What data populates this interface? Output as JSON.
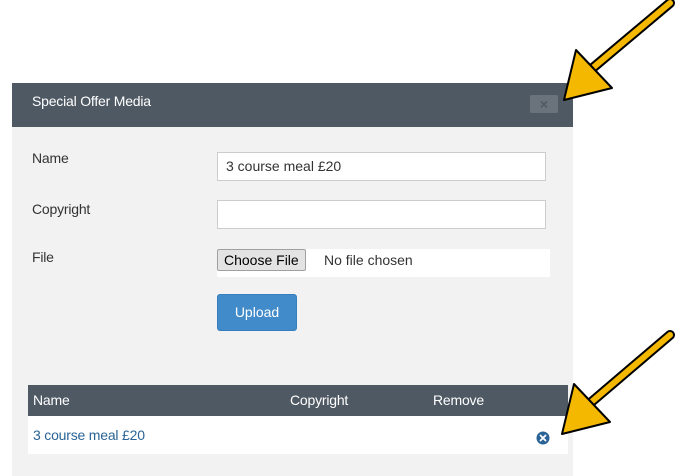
{
  "dialog": {
    "title": "Special Offer Media",
    "close_label": "×",
    "form": {
      "name_label": "Name",
      "name_value": "3 course meal £20",
      "copyright_label": "Copyright",
      "copyright_value": "",
      "file_label": "File",
      "choose_file_label": "Choose File",
      "no_file_text": "No file chosen",
      "upload_label": "Upload"
    },
    "table": {
      "headers": [
        "Name",
        "Copyright",
        "Remove"
      ],
      "rows": [
        {
          "name": "3 course meal £20",
          "copyright": ""
        }
      ]
    }
  },
  "colors": {
    "header_bg": "#4f5964",
    "body_bg": "#f2f2f2",
    "primary_button": "#428bca",
    "link": "#2a6496",
    "annotation_arrow": "#f5b800"
  },
  "icons": [
    "close-icon",
    "remove-icon",
    "arrow-annotation"
  ]
}
